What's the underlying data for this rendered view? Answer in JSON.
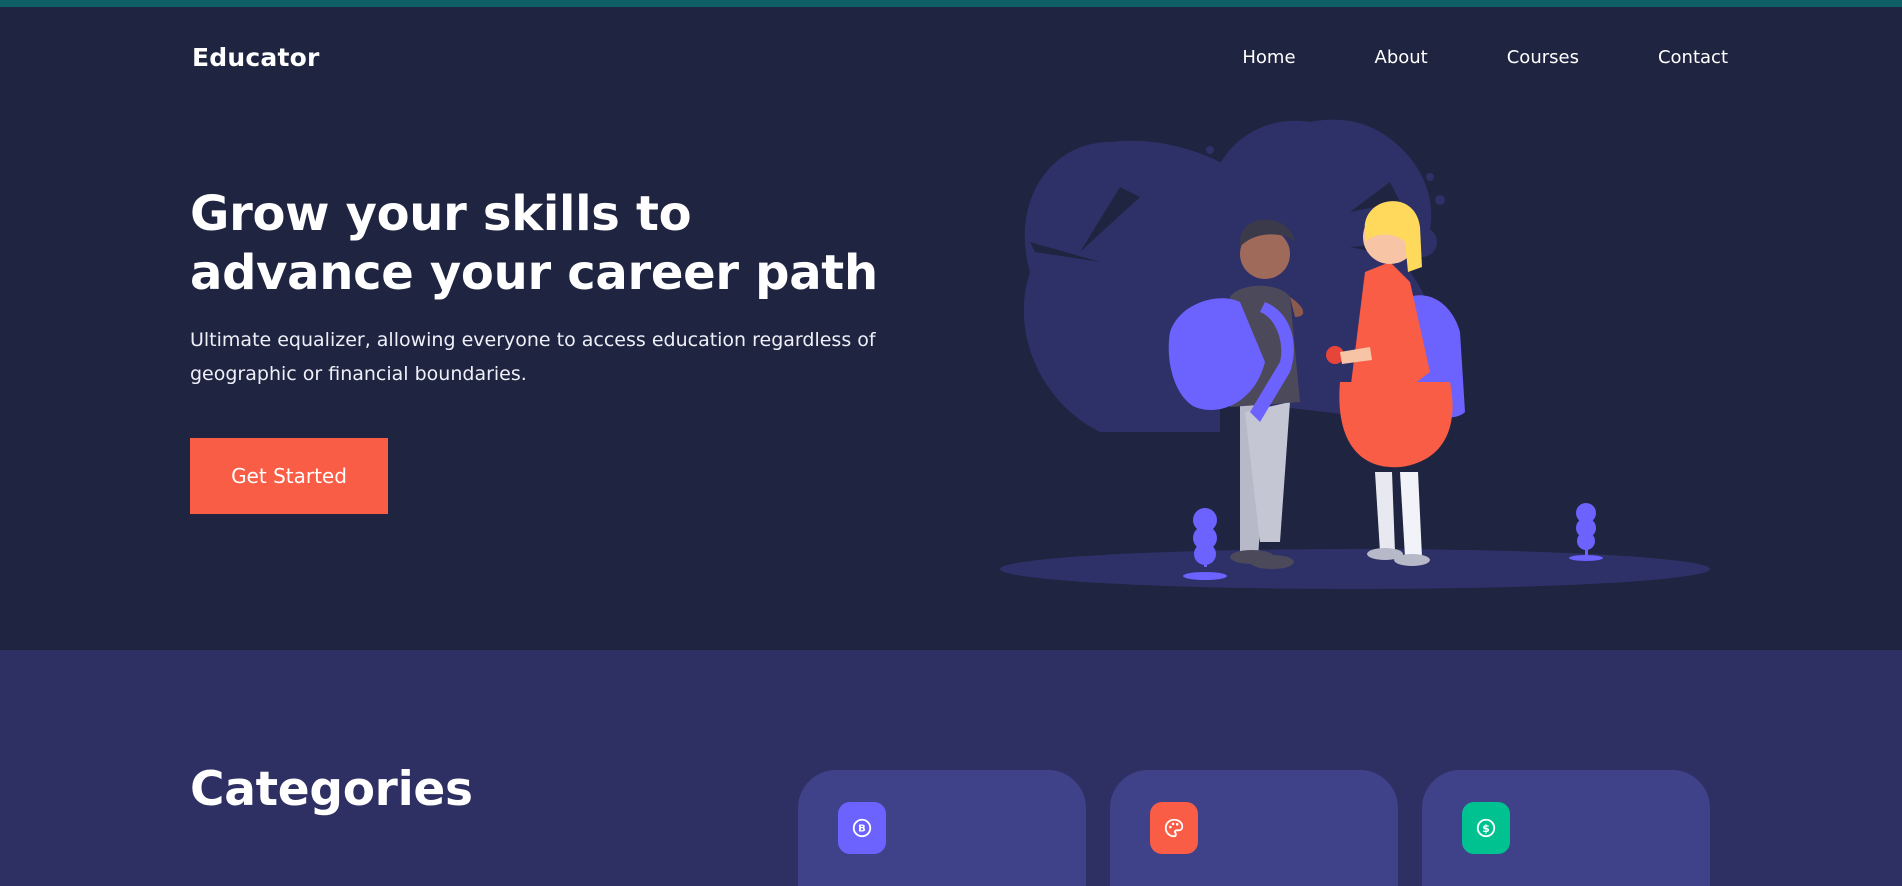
{
  "brand": {
    "name": "Educator"
  },
  "nav": {
    "items": [
      {
        "label": "Home"
      },
      {
        "label": "About"
      },
      {
        "label": "Courses"
      },
      {
        "label": "Contact"
      }
    ]
  },
  "hero": {
    "headline": "Grow your skills to advance your career path",
    "subtext": "Ultimate equalizer, allowing everyone to access education regardless of geographic or financial boundaries.",
    "cta_label": "Get Started"
  },
  "categories": {
    "title": "Categories",
    "cards": [
      {
        "icon": "bitcoin-icon",
        "color": "#6c63ff"
      },
      {
        "icon": "palette-icon",
        "color": "#fa5d45"
      },
      {
        "icon": "dollar-icon",
        "color": "#00c190"
      }
    ]
  },
  "colors": {
    "hero_bg": "#1f2440",
    "categories_bg": "#2e2f62",
    "card_bg": "#3f4289",
    "accent": "#fa5d45",
    "top_strip": "#0e5f66"
  }
}
